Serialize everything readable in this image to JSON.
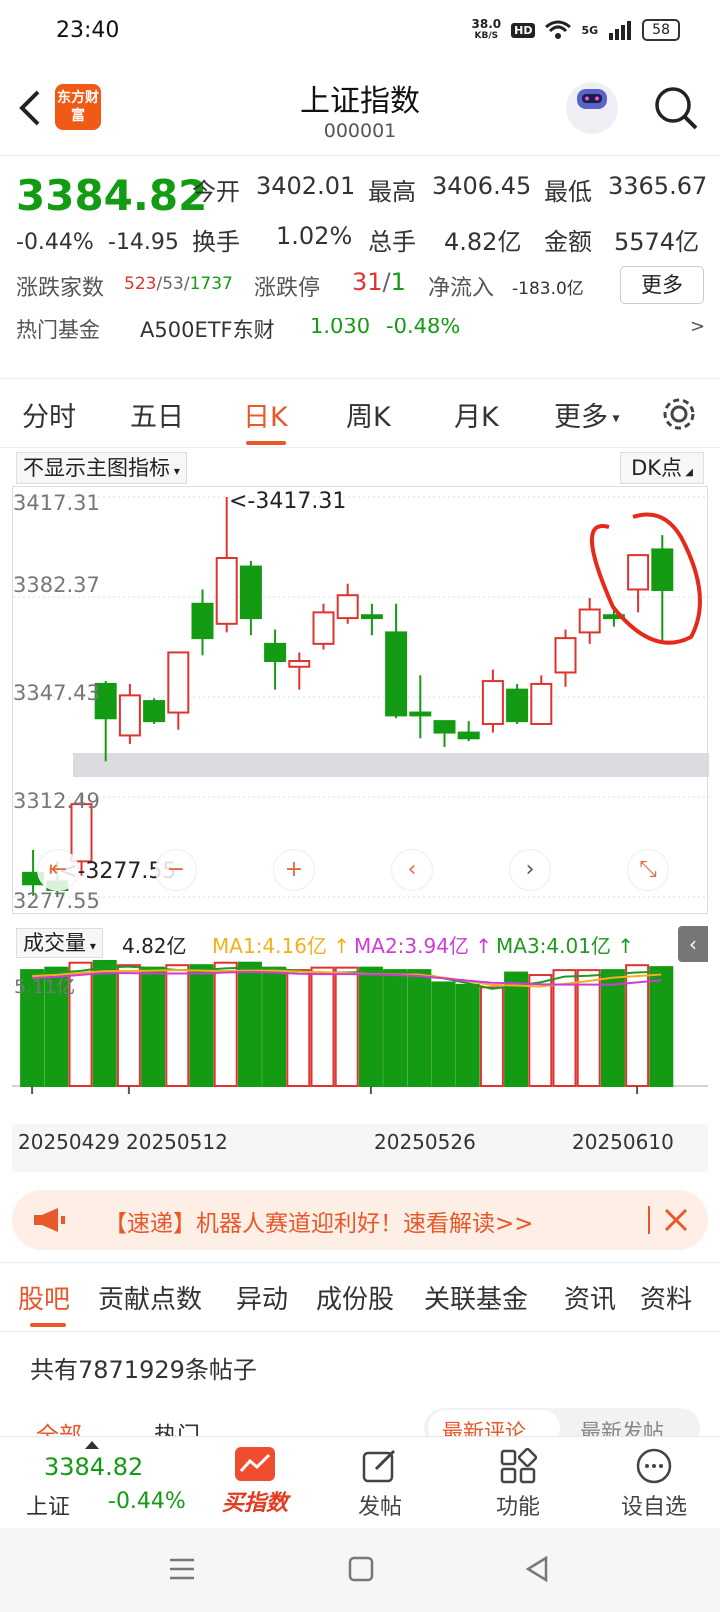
{
  "status": {
    "time": "23:40",
    "net_speed": "38.0",
    "net_unit": "KB/S",
    "hd": "HD",
    "signal": "5G",
    "battery": "58"
  },
  "header": {
    "logo_text": "东方财富",
    "title": "上证指数",
    "code": "000001"
  },
  "quote": {
    "price": "3384.82",
    "change_pct": "-0.44%",
    "change": "-14.95",
    "open_label": "今开",
    "open": "3402.01",
    "high_label": "最高",
    "high": "3406.45",
    "low_label": "最低",
    "low": "3365.67",
    "turnover_label": "换手",
    "turnover": "1.02%",
    "volume_label": "总手",
    "volume": "4.82亿",
    "amount_label": "金额",
    "amount": "5574亿",
    "updown_label": "涨跌家数",
    "up_count": "523",
    "flat_count": "53",
    "down_count": "1737",
    "limit_label": "涨跌停",
    "limit_up": "31",
    "limit_down": "1",
    "netflow_label": "净流入",
    "netflow": "-183.0亿",
    "more_label": "更多",
    "fund_label": "热门基金",
    "fund_name": "A500ETF东财",
    "fund_price": "1.030",
    "fund_pct": "-0.48%"
  },
  "period_tabs": [
    "分时",
    "五日",
    "日K",
    "周K",
    "月K",
    "更多"
  ],
  "active_tab": "日K",
  "chart_controls": {
    "indicator_select": "不显示主图指标",
    "dk_label": "DK点"
  },
  "chart_data": {
    "type": "candlestick",
    "y_ticks": [
      "3417.31",
      "3382.37",
      "3347.43",
      "3312.49",
      "3277.55"
    ],
    "ylim": [
      3277.55,
      3417.31
    ],
    "max_label": "<-3417.31",
    "min_label": "<-3277.55",
    "candles": [
      {
        "o": 3286,
        "h": 3294,
        "l": 3278,
        "c": 3282
      },
      {
        "o": 3283,
        "h": 3290,
        "l": 3277.55,
        "c": 3280
      },
      {
        "o": 3290,
        "h": 3313,
        "l": 3285,
        "c": 3310
      },
      {
        "o": 3352,
        "h": 3353,
        "l": 3325,
        "c": 3340
      },
      {
        "o": 3334,
        "h": 3352,
        "l": 3331,
        "c": 3348
      },
      {
        "o": 3346,
        "h": 3347,
        "l": 3338,
        "c": 3339
      },
      {
        "o": 3342,
        "h": 3356,
        "l": 3336,
        "c": 3363
      },
      {
        "o": 3380,
        "h": 3385,
        "l": 3362,
        "c": 3368
      },
      {
        "o": 3373,
        "h": 3417.31,
        "l": 3370,
        "c": 3396
      },
      {
        "o": 3393,
        "h": 3395,
        "l": 3369,
        "c": 3375
      },
      {
        "o": 3366,
        "h": 3371,
        "l": 3350,
        "c": 3360
      },
      {
        "o": 3358,
        "h": 3363,
        "l": 3350,
        "c": 3360
      },
      {
        "o": 3366,
        "h": 3380,
        "l": 3364,
        "c": 3377
      },
      {
        "o": 3375,
        "h": 3387,
        "l": 3373,
        "c": 3383
      },
      {
        "o": 3376,
        "h": 3380,
        "l": 3369,
        "c": 3375
      },
      {
        "o": 3370,
        "h": 3380,
        "l": 3340,
        "c": 3341
      },
      {
        "o": 3342,
        "h": 3355,
        "l": 3333,
        "c": 3341
      },
      {
        "o": 3339,
        "h": 3338,
        "l": 3330,
        "c": 3335
      },
      {
        "o": 3335,
        "h": 3339,
        "l": 3332,
        "c": 3333
      },
      {
        "o": 3338,
        "h": 3357,
        "l": 3335,
        "c": 3353
      },
      {
        "o": 3350,
        "h": 3352,
        "l": 3338,
        "c": 3339
      },
      {
        "o": 3338,
        "h": 3355,
        "l": 3338,
        "c": 3352
      },
      {
        "o": 3356,
        "h": 3371,
        "l": 3351,
        "c": 3368
      },
      {
        "o": 3370,
        "h": 3382,
        "l": 3366,
        "c": 3378
      },
      {
        "o": 3376,
        "h": 3378,
        "l": 3372,
        "c": 3375
      },
      {
        "o": 3385,
        "h": 3396,
        "l": 3377,
        "c": 3397
      },
      {
        "o": 3399,
        "h": 3404,
        "l": 3367,
        "c": 3384.82
      }
    ],
    "volume_label": "成交量",
    "volume_value": "4.82亿",
    "ma1": "MA1:4.16亿",
    "ma2": "MA2:3.94亿",
    "ma3": "MA3:4.01亿",
    "vol_tick": "5.11亿",
    "vol_ylim": [
      0,
      5.11
    ],
    "volumes": [
      4.7,
      4.8,
      5.0,
      5.11,
      4.9,
      4.8,
      4.9,
      4.9,
      5.0,
      5.0,
      4.8,
      4.7,
      4.8,
      4.8,
      4.8,
      4.7,
      4.7,
      4.2,
      4.1,
      4.0,
      4.6,
      4.5,
      4.7,
      4.7,
      4.7,
      4.9,
      4.82
    ],
    "dates": [
      "20250429",
      "20250512",
      "20250526",
      "20250610"
    ],
    "colors": {
      "up": "#e0332f",
      "down": "#139b13",
      "ma1": "#f2b11a",
      "ma2": "#d23ad6",
      "ma3": "#1f9a1f"
    }
  },
  "banner": {
    "text": "【速递】机器人赛道迎利好！速看解读>>"
  },
  "section_tabs": [
    "股吧",
    "贡献点数",
    "异动",
    "成份股",
    "关联基金",
    "资讯",
    "资料"
  ],
  "posts": {
    "count_text": "共有7871929条帖子",
    "sub_tab1": "全部",
    "sub_tab2": "热门",
    "sort1": "最新评论",
    "sort2": "最新发帖"
  },
  "bottom": {
    "index_price": "3384.82",
    "index_name": "上证",
    "index_pct": "-0.44%",
    "buy": "买指数",
    "post": "发帖",
    "functions": "功能",
    "watchlist": "设自选"
  }
}
